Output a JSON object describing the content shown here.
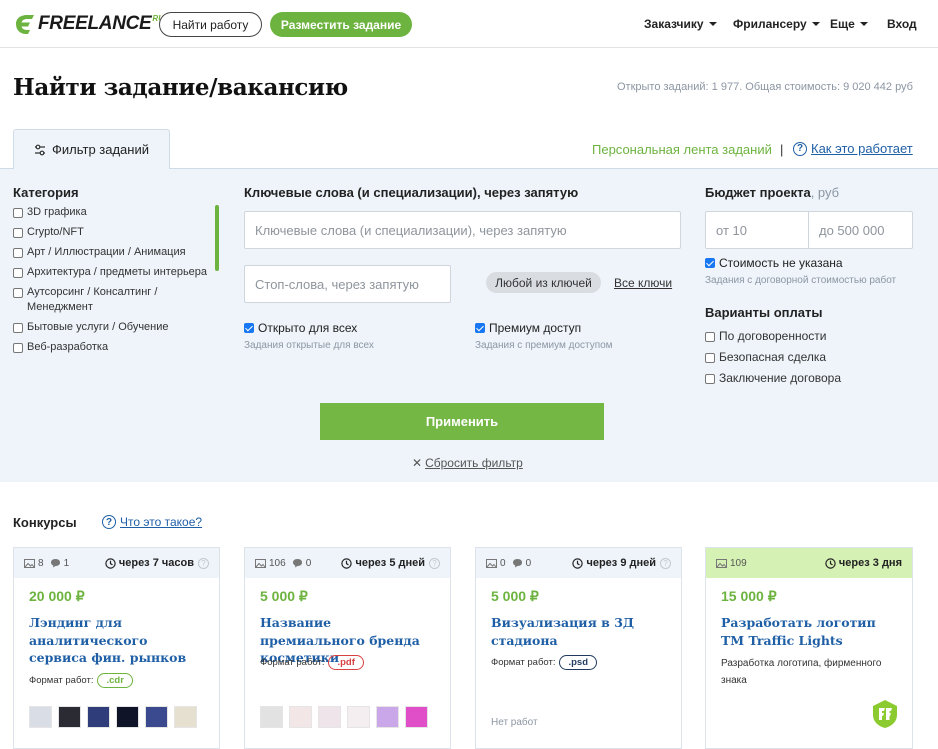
{
  "header": {
    "logo_text": "FREELANCE",
    "logo_suffix": "RU",
    "find_work_label": "Найти работу",
    "post_task_label": "Разместить задание",
    "nav": [
      {
        "label": "Заказчику"
      },
      {
        "label": "Фрилансеру"
      },
      {
        "label": "Еще"
      }
    ],
    "login_label": "Вход"
  },
  "page": {
    "title": "Найти задание/вакансию",
    "stats": "Открыто заданий: 1 977. Общая стоимость: 9 020 442 руб"
  },
  "filter": {
    "tab_label": "Фильтр заданий",
    "personal_feed_label": "Персональная лента заданий",
    "separator": "|",
    "how_it_works_label": "Как это работает",
    "category_label": "Категория",
    "categories": [
      "3D графика",
      "Crypto/NFT",
      "Арт / Иллюстрации / Анимация",
      "Архитектура / предметы интерьера",
      "Аутсорсинг / Консалтинг / Менеджмент",
      "Бытовые услуги / Обучение",
      "Веб-разработка"
    ],
    "keywords_label": "Ключевые слова (и специализации), через запятую",
    "keywords_placeholder": "Ключевые слова (и специализации), через запятую",
    "stopwords_placeholder": "Стоп-слова, через запятую",
    "any_key_label": "Любой из ключей",
    "all_keys_label": "Все ключи",
    "open_for_all_label": "Открыто для всех",
    "open_for_all_sub": "Задания открытые для всех",
    "premium_label": "Премиум доступ",
    "premium_sub": "Задания с премиум доступом",
    "budget_label": "Бюджет проекта",
    "budget_unit": ", руб",
    "budget_from_placeholder": "от 10",
    "budget_to_placeholder": "до 500 000",
    "no_price_label": "Стоимость не указана",
    "no_price_sub": "Задания с договорной стоимостью работ",
    "payment_label": "Варианты оплаты",
    "payment_options": [
      "По договоренности",
      "Безопасная сделка",
      "Заключение договора"
    ],
    "apply_label": "Применить",
    "reset_label": "Сбросить фильтр"
  },
  "contests": {
    "title": "Конкурсы",
    "what_label": "Что это такое?",
    "format_label": "Формат работ:",
    "cards": [
      {
        "images": "8",
        "comments": "1",
        "deadline": "через 7 часов",
        "price": "20 000 ₽",
        "title": "Лэндинг для аналитического сервиса фин. рынков",
        "format": ".cdr",
        "format_color": "#6db33f",
        "thumbs": [
          "#d8dde6",
          "#2b2b34",
          "#2f3e7a",
          "#101428",
          "#3b4a8f",
          "#e6e0d0"
        ]
      },
      {
        "images": "106",
        "comments": "0",
        "deadline": "через 5 дней",
        "price": "5 000 ₽",
        "title": "Название премиального бренда косметики",
        "format": ".pdf",
        "format_color": "#d94040",
        "thumbs": [
          "#e2e2e2",
          "#f2e6e6",
          "#efe4ea",
          "#f4eef0",
          "#c9a7e8",
          "#e04fc7"
        ]
      },
      {
        "images": "0",
        "comments": "0",
        "deadline": "через 9 дней",
        "price": "5 000 ₽",
        "title": "Визуализация в 3Д стадиона",
        "format": ".psd",
        "format_color": "#1f3a5e",
        "no_works": "Нет работ"
      },
      {
        "images": "109",
        "deadline": "через 3 дня",
        "price": "15 000 ₽",
        "title": "Разработать логотип ТМ Traffic Lights",
        "description": "Разработка логотипа, фирменного знака"
      }
    ]
  },
  "colors": {
    "accent_green": "#6db33f",
    "link_blue": "#1f5fa6",
    "panel_bg": "#eef4fa"
  }
}
